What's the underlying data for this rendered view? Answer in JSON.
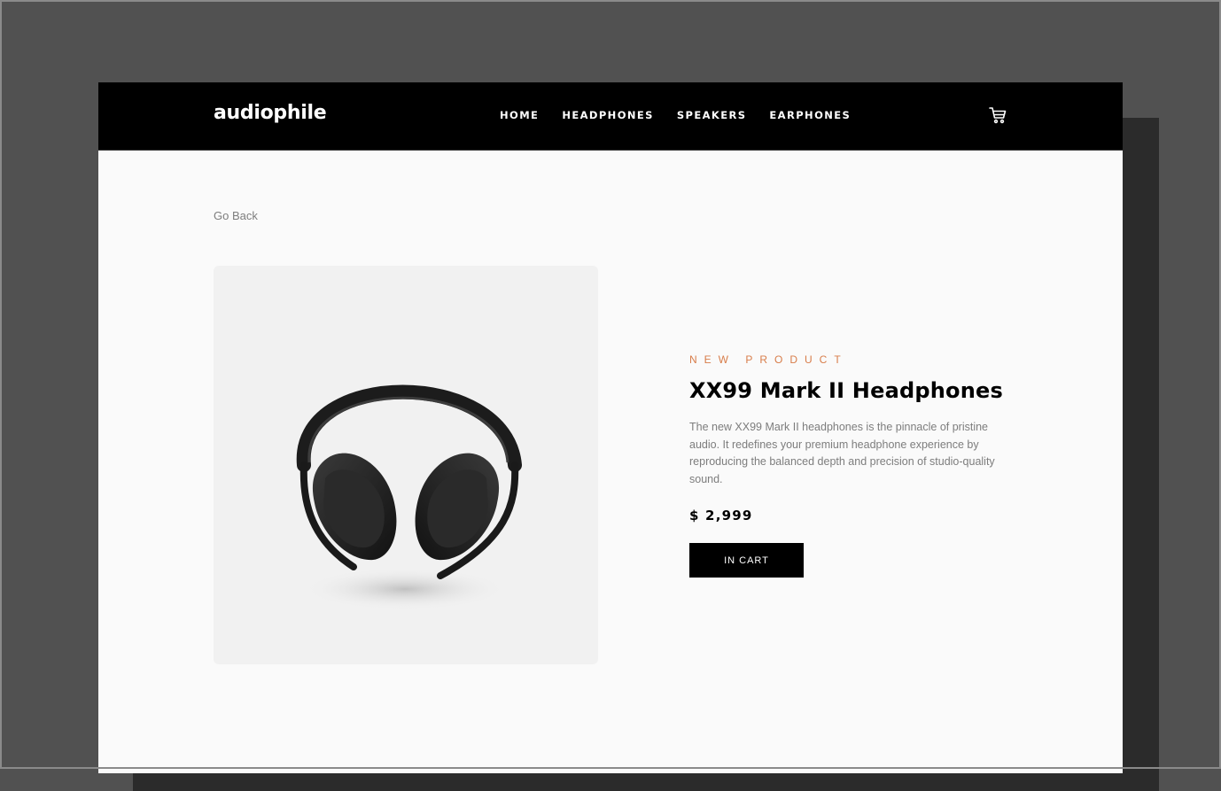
{
  "header": {
    "logo": "audiophile",
    "nav": [
      "HOME",
      "HEADPHONES",
      "SPEAKERS",
      "EARPHONES"
    ],
    "cart_icon": "cart-icon"
  },
  "main": {
    "go_back": "Go Back",
    "product": {
      "overline": "NEW PRODUCT",
      "name": "XX99 Mark II Headphones",
      "description": "The new XX99 Mark II headphones is the pinnacle of pristine audio. It redefines your premium headphone experience by reproducing the balanced depth and precision of studio-quality sound.",
      "price": "$ 2,999",
      "button_label": "IN CART"
    }
  },
  "colors": {
    "accent": "#d87d4a",
    "header_bg": "#000000",
    "page_bg": "#fafafa",
    "image_bg": "#f1f1f1"
  }
}
